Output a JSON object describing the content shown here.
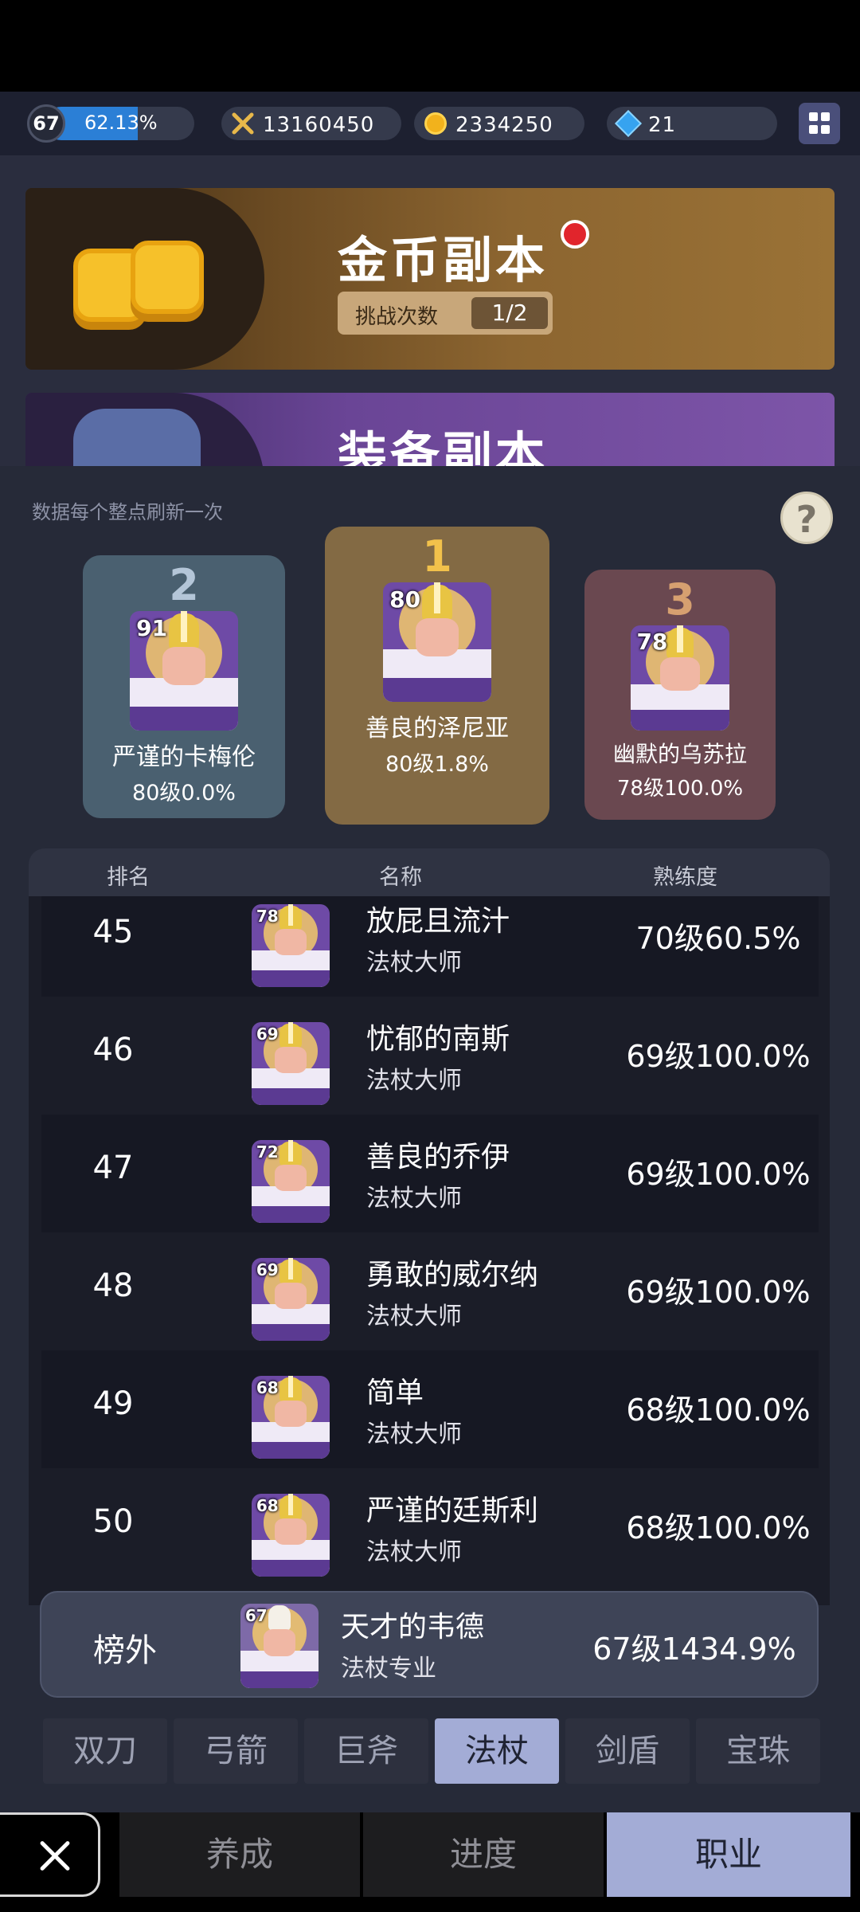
{
  "topbar": {
    "level": "67",
    "xp_percent": "62.13%",
    "xp_fraction": 0.6213,
    "power": "13160450",
    "gold": "2334250",
    "gems": "21"
  },
  "dungeons": {
    "gold": {
      "title": "金币副本",
      "tries_label": "挑战次数",
      "tries_count": "1/2"
    },
    "equipment": {
      "title": "装备副本"
    }
  },
  "ranking": {
    "refresh_note": "数据每个整点刷新一次",
    "help_label": "?",
    "podium": [
      {
        "place": "1",
        "name": "善良的泽尼亚",
        "level": "80级1.8%",
        "avatar_level": "80"
      },
      {
        "place": "2",
        "name": "严谨的卡梅伦",
        "level": "80级0.0%",
        "avatar_level": "91"
      },
      {
        "place": "3",
        "name": "幽默的乌苏拉",
        "level": "78级100.0%",
        "avatar_level": "78"
      }
    ],
    "columns": {
      "rank": "排名",
      "name": "名称",
      "proficiency": "熟练度"
    },
    "rows": [
      {
        "rank": "45",
        "avatar_level": "78",
        "name": "放屁且流汁",
        "class": "法杖大师",
        "proficiency": "70级60.5%"
      },
      {
        "rank": "46",
        "avatar_level": "69",
        "name": "忧郁的南斯",
        "class": "法杖大师",
        "proficiency": "69级100.0%"
      },
      {
        "rank": "47",
        "avatar_level": "72",
        "name": "善良的乔伊",
        "class": "法杖大师",
        "proficiency": "69级100.0%"
      },
      {
        "rank": "48",
        "avatar_level": "69",
        "name": "勇敢的威尔纳",
        "class": "法杖大师",
        "proficiency": "69级100.0%"
      },
      {
        "rank": "49",
        "avatar_level": "68",
        "name": "简单",
        "class": "法杖大师",
        "proficiency": "68级100.0%"
      },
      {
        "rank": "50",
        "avatar_level": "68",
        "name": "严谨的廷斯利",
        "class": "法杖大师",
        "proficiency": "68级100.0%"
      }
    ],
    "me": {
      "rank": "榜外",
      "avatar_level": "67",
      "name": "天才的韦德",
      "class": "法杖专业",
      "proficiency": "67级1434.9%"
    }
  },
  "weapon_tabs": [
    "双刀",
    "弓箭",
    "巨斧",
    "法杖",
    "剑盾",
    "宝珠"
  ],
  "weapon_tab_active": "法杖",
  "bottom_tabs": [
    "养成",
    "进度",
    "职业"
  ],
  "bottom_tab_active": "职业",
  "colors": {
    "accent": "#a3acd6",
    "xp_bar": "#2b7fd6",
    "gold_banner": "#8c6530",
    "podium_first": "#836a44",
    "podium_second": "#4a6070",
    "podium_third": "#6a4850"
  },
  "icons": {
    "power": "crossed-swords-icon",
    "gold": "coin-icon",
    "gems": "diamond-icon",
    "menu": "grid-menu-icon",
    "close": "close-icon",
    "help": "question-mark-icon"
  }
}
